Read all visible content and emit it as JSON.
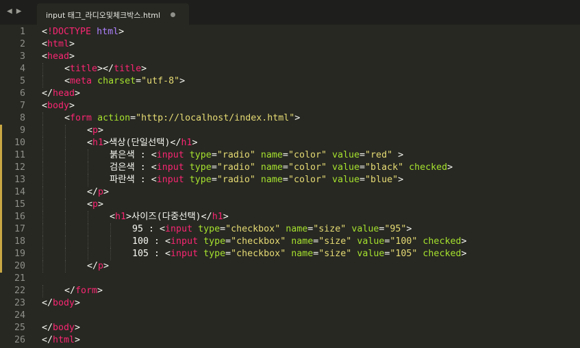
{
  "tab": {
    "nav_back": "◀",
    "nav_forward": "▶",
    "title": "input 태그_라디오및체크박스.html"
  },
  "editor": {
    "lines": [
      {
        "num": "1",
        "indent": 0,
        "tokens": [
          [
            "t",
            "<"
          ],
          [
            "g",
            "!DOCTYPE"
          ],
          [
            "t",
            " "
          ],
          [
            "k",
            "html"
          ],
          [
            "t",
            ">"
          ]
        ]
      },
      {
        "num": "2",
        "indent": 0,
        "tokens": [
          [
            "t",
            "<"
          ],
          [
            "g",
            "html"
          ],
          [
            "t",
            ">"
          ]
        ]
      },
      {
        "num": "3",
        "indent": 0,
        "tokens": [
          [
            "t",
            "<"
          ],
          [
            "g",
            "head"
          ],
          [
            "t",
            ">"
          ]
        ]
      },
      {
        "num": "4",
        "indent": 1,
        "tokens": [
          [
            "t",
            "<"
          ],
          [
            "g",
            "title"
          ],
          [
            "t",
            "></"
          ],
          [
            "g",
            "title"
          ],
          [
            "t",
            ">"
          ]
        ]
      },
      {
        "num": "5",
        "indent": 1,
        "tokens": [
          [
            "t",
            "<"
          ],
          [
            "g",
            "meta"
          ],
          [
            "t",
            " "
          ],
          [
            "a",
            "charset"
          ],
          [
            "t",
            "="
          ],
          [
            "s",
            "\"utf-8\""
          ],
          [
            "t",
            ">"
          ]
        ]
      },
      {
        "num": "6",
        "indent": 0,
        "tokens": [
          [
            "t",
            "</"
          ],
          [
            "g",
            "head"
          ],
          [
            "t",
            ">"
          ]
        ]
      },
      {
        "num": "7",
        "indent": 0,
        "tokens": [
          [
            "t",
            "<"
          ],
          [
            "g",
            "body"
          ],
          [
            "t",
            ">"
          ]
        ]
      },
      {
        "num": "8",
        "indent": 1,
        "tokens": [
          [
            "t",
            "<"
          ],
          [
            "g",
            "form"
          ],
          [
            "t",
            " "
          ],
          [
            "a",
            "action"
          ],
          [
            "t",
            "="
          ],
          [
            "s",
            "\"http://localhost/index.html\""
          ],
          [
            "t",
            ">"
          ]
        ]
      },
      {
        "num": "9",
        "indent": 2,
        "tokens": [
          [
            "t",
            "<"
          ],
          [
            "g",
            "p"
          ],
          [
            "t",
            ">"
          ]
        ]
      },
      {
        "num": "10",
        "indent": 2,
        "tokens": [
          [
            "t",
            "<"
          ],
          [
            "g",
            "h1"
          ],
          [
            "t",
            ">색상(단일선택)</"
          ],
          [
            "g",
            "h1"
          ],
          [
            "t",
            ">"
          ]
        ]
      },
      {
        "num": "11",
        "indent": 3,
        "tokens": [
          [
            "t",
            "붉은색 : <"
          ],
          [
            "g",
            "input"
          ],
          [
            "t",
            " "
          ],
          [
            "a",
            "type"
          ],
          [
            "t",
            "="
          ],
          [
            "s",
            "\"radio\""
          ],
          [
            "t",
            " "
          ],
          [
            "a",
            "name"
          ],
          [
            "t",
            "="
          ],
          [
            "s",
            "\"color\""
          ],
          [
            "t",
            " "
          ],
          [
            "a",
            "value"
          ],
          [
            "t",
            "="
          ],
          [
            "s",
            "\"red\""
          ],
          [
            "t",
            " >"
          ]
        ]
      },
      {
        "num": "12",
        "indent": 3,
        "tokens": [
          [
            "t",
            "검은색 : <"
          ],
          [
            "g",
            "input"
          ],
          [
            "t",
            " "
          ],
          [
            "a",
            "type"
          ],
          [
            "t",
            "="
          ],
          [
            "s",
            "\"radio\""
          ],
          [
            "t",
            " "
          ],
          [
            "a",
            "name"
          ],
          [
            "t",
            "="
          ],
          [
            "s",
            "\"color\""
          ],
          [
            "t",
            " "
          ],
          [
            "a",
            "value"
          ],
          [
            "t",
            "="
          ],
          [
            "s",
            "\"black\""
          ],
          [
            "t",
            " "
          ],
          [
            "a",
            "checked"
          ],
          [
            "t",
            ">"
          ]
        ]
      },
      {
        "num": "13",
        "indent": 3,
        "tokens": [
          [
            "t",
            "파란색 : <"
          ],
          [
            "g",
            "input"
          ],
          [
            "t",
            " "
          ],
          [
            "a",
            "type"
          ],
          [
            "t",
            "="
          ],
          [
            "s",
            "\"radio\""
          ],
          [
            "t",
            " "
          ],
          [
            "a",
            "name"
          ],
          [
            "t",
            "="
          ],
          [
            "s",
            "\"color\""
          ],
          [
            "t",
            " "
          ],
          [
            "a",
            "value"
          ],
          [
            "t",
            "="
          ],
          [
            "s",
            "\"blue\""
          ],
          [
            "t",
            ">"
          ]
        ]
      },
      {
        "num": "14",
        "indent": 2,
        "tokens": [
          [
            "t",
            "</"
          ],
          [
            "g",
            "p"
          ],
          [
            "t",
            ">"
          ]
        ]
      },
      {
        "num": "15",
        "indent": 2,
        "tokens": [
          [
            "t",
            "<"
          ],
          [
            "g",
            "p"
          ],
          [
            "t",
            ">"
          ]
        ]
      },
      {
        "num": "16",
        "indent": 3,
        "tokens": [
          [
            "t",
            "<"
          ],
          [
            "g",
            "h1"
          ],
          [
            "t",
            ">사이즈(다중선택)</"
          ],
          [
            "g",
            "h1"
          ],
          [
            "t",
            ">"
          ]
        ]
      },
      {
        "num": "17",
        "indent": 4,
        "tokens": [
          [
            "t",
            "95 : <"
          ],
          [
            "g",
            "input"
          ],
          [
            "t",
            " "
          ],
          [
            "a",
            "type"
          ],
          [
            "t",
            "="
          ],
          [
            "s",
            "\"checkbox\""
          ],
          [
            "t",
            " "
          ],
          [
            "a",
            "name"
          ],
          [
            "t",
            "="
          ],
          [
            "s",
            "\"size\""
          ],
          [
            "t",
            " "
          ],
          [
            "a",
            "value"
          ],
          [
            "t",
            "="
          ],
          [
            "s",
            "\"95\""
          ],
          [
            "t",
            ">"
          ]
        ]
      },
      {
        "num": "18",
        "indent": 4,
        "tokens": [
          [
            "t",
            "100 : <"
          ],
          [
            "g",
            "input"
          ],
          [
            "t",
            " "
          ],
          [
            "a",
            "type"
          ],
          [
            "t",
            "="
          ],
          [
            "s",
            "\"checkbox\""
          ],
          [
            "t",
            " "
          ],
          [
            "a",
            "name"
          ],
          [
            "t",
            "="
          ],
          [
            "s",
            "\"size\""
          ],
          [
            "t",
            " "
          ],
          [
            "a",
            "value"
          ],
          [
            "t",
            "="
          ],
          [
            "s",
            "\"100\""
          ],
          [
            "t",
            " "
          ],
          [
            "a",
            "checked"
          ],
          [
            "t",
            ">"
          ]
        ]
      },
      {
        "num": "19",
        "indent": 4,
        "tokens": [
          [
            "t",
            "105 : <"
          ],
          [
            "g",
            "input"
          ],
          [
            "t",
            " "
          ],
          [
            "a",
            "type"
          ],
          [
            "t",
            "="
          ],
          [
            "s",
            "\"checkbox\""
          ],
          [
            "t",
            " "
          ],
          [
            "a",
            "name"
          ],
          [
            "t",
            "="
          ],
          [
            "s",
            "\"size\""
          ],
          [
            "t",
            " "
          ],
          [
            "a",
            "value"
          ],
          [
            "t",
            "="
          ],
          [
            "s",
            "\"105\""
          ],
          [
            "t",
            " "
          ],
          [
            "a",
            "checked"
          ],
          [
            "t",
            ">"
          ]
        ]
      },
      {
        "num": "20",
        "indent": 2,
        "tokens": [
          [
            "t",
            "</"
          ],
          [
            "g",
            "p"
          ],
          [
            "t",
            ">"
          ]
        ]
      },
      {
        "num": "21",
        "indent": 0,
        "tokens": []
      },
      {
        "num": "22",
        "indent": 1,
        "tokens": [
          [
            "t",
            "</"
          ],
          [
            "g",
            "form"
          ],
          [
            "t",
            ">"
          ]
        ]
      },
      {
        "num": "23",
        "indent": 0,
        "tokens": [
          [
            "t",
            "</"
          ],
          [
            "g",
            "body"
          ],
          [
            "t",
            ">"
          ]
        ]
      },
      {
        "num": "24",
        "indent": 0,
        "tokens": []
      },
      {
        "num": "25",
        "indent": 0,
        "tokens": [
          [
            "t",
            "</"
          ],
          [
            "g",
            "body"
          ],
          [
            "t",
            ">"
          ]
        ]
      },
      {
        "num": "26",
        "indent": 0,
        "tokens": [
          [
            "t",
            "</"
          ],
          [
            "g",
            "html"
          ],
          [
            "t",
            ">"
          ]
        ]
      }
    ],
    "modified_lines": [
      "9",
      "10",
      "11",
      "12",
      "13",
      "14",
      "15",
      "16",
      "17",
      "18",
      "19",
      "20"
    ]
  },
  "colors": {
    "background": "#272822",
    "tab_bar": "#1e1f1c",
    "tag": "#f92672",
    "attribute": "#a6e22e",
    "string": "#e6db74",
    "keyword": "#ae81ff",
    "text": "#f8f8f2",
    "line_number": "#8f908a",
    "modified_marker": "#c9a844"
  },
  "icons": {
    "nav_back": "chevron-left-icon",
    "nav_forward": "chevron-right-icon",
    "dirty_indicator": "unsaved-dot-icon"
  }
}
